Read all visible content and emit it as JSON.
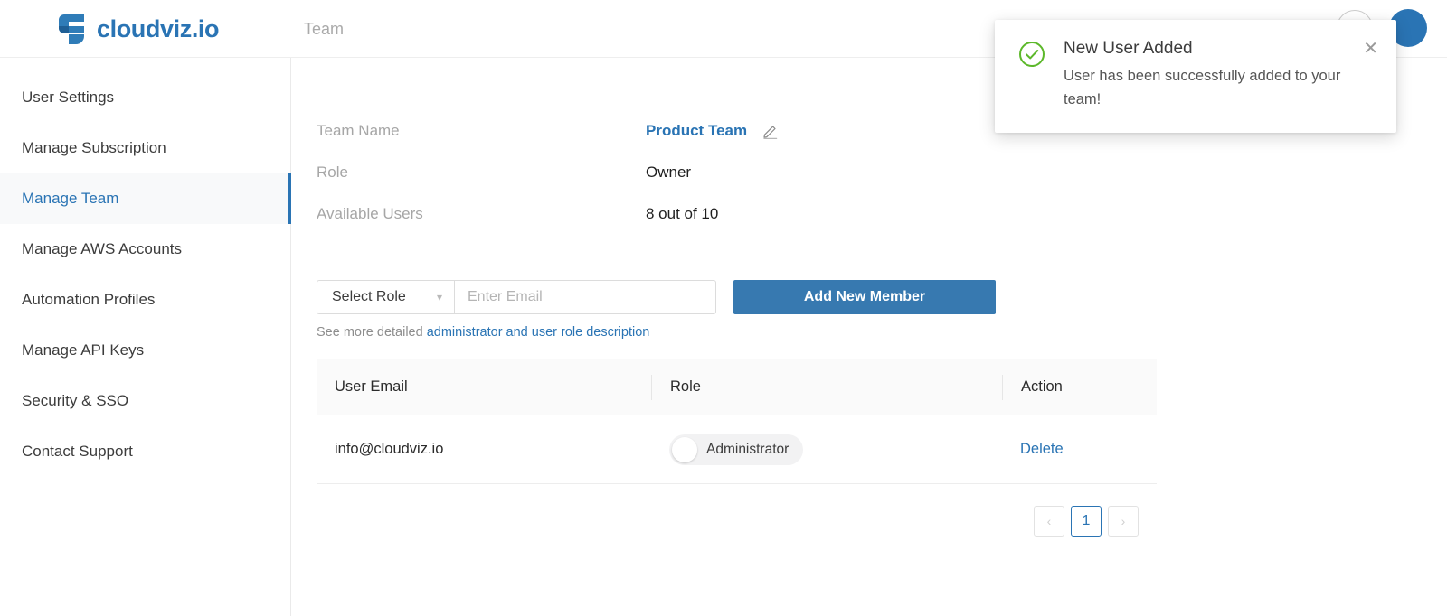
{
  "header": {
    "logo_text": "cloudviz.io",
    "logo_icon": "cloudviz-logo-icon",
    "breadcrumb": "Team",
    "help_icon": "question-mark-icon",
    "help_glyph": "?",
    "avatar_initial": ""
  },
  "sidebar": {
    "items": [
      {
        "label": "User Settings",
        "active": false
      },
      {
        "label": "Manage Subscription",
        "active": false
      },
      {
        "label": "Manage Team",
        "active": true
      },
      {
        "label": "Manage AWS Accounts",
        "active": false
      },
      {
        "label": "Automation Profiles",
        "active": false
      },
      {
        "label": "Manage API Keys",
        "active": false
      },
      {
        "label": "Security & SSO",
        "active": false
      },
      {
        "label": "Contact Support",
        "active": false
      }
    ]
  },
  "info": {
    "rows": [
      {
        "label": "Team Name",
        "value": "Product Team",
        "accent": true,
        "edit_icon": "pencil-edit-icon"
      },
      {
        "label": "Role",
        "value": "Owner",
        "accent": false
      },
      {
        "label": "Available Users",
        "value": "8 out of 10",
        "accent": false
      }
    ]
  },
  "form": {
    "role_select_label": "Select Role",
    "role_select_chevron": "chevron-down-icon",
    "email_placeholder": "Enter Email",
    "email_value": "",
    "add_button_label": "Add New Member",
    "hint_prefix": "See more detailed ",
    "hint_link": "administrator and user role description"
  },
  "table": {
    "columns": [
      "User Email",
      "Role",
      "Action"
    ],
    "rows": [
      {
        "email": "info@cloudviz.io",
        "role_label": "Administrator",
        "role_toggle_on": false,
        "action_label": "Delete"
      }
    ]
  },
  "pagination": {
    "prev_glyph": "‹",
    "next_glyph": "›",
    "current_page": "1"
  },
  "toast": {
    "status_icon": "success-check-circle-icon",
    "title": "New User Added",
    "message": "User has been successfully added to your team!",
    "close_icon": "close-icon",
    "close_glyph": "✕"
  },
  "colors": {
    "brand_blue": "#2a74b4",
    "button_blue": "#3779b0",
    "success_green": "#5cb82a",
    "muted_gray": "#a6a6a6"
  }
}
